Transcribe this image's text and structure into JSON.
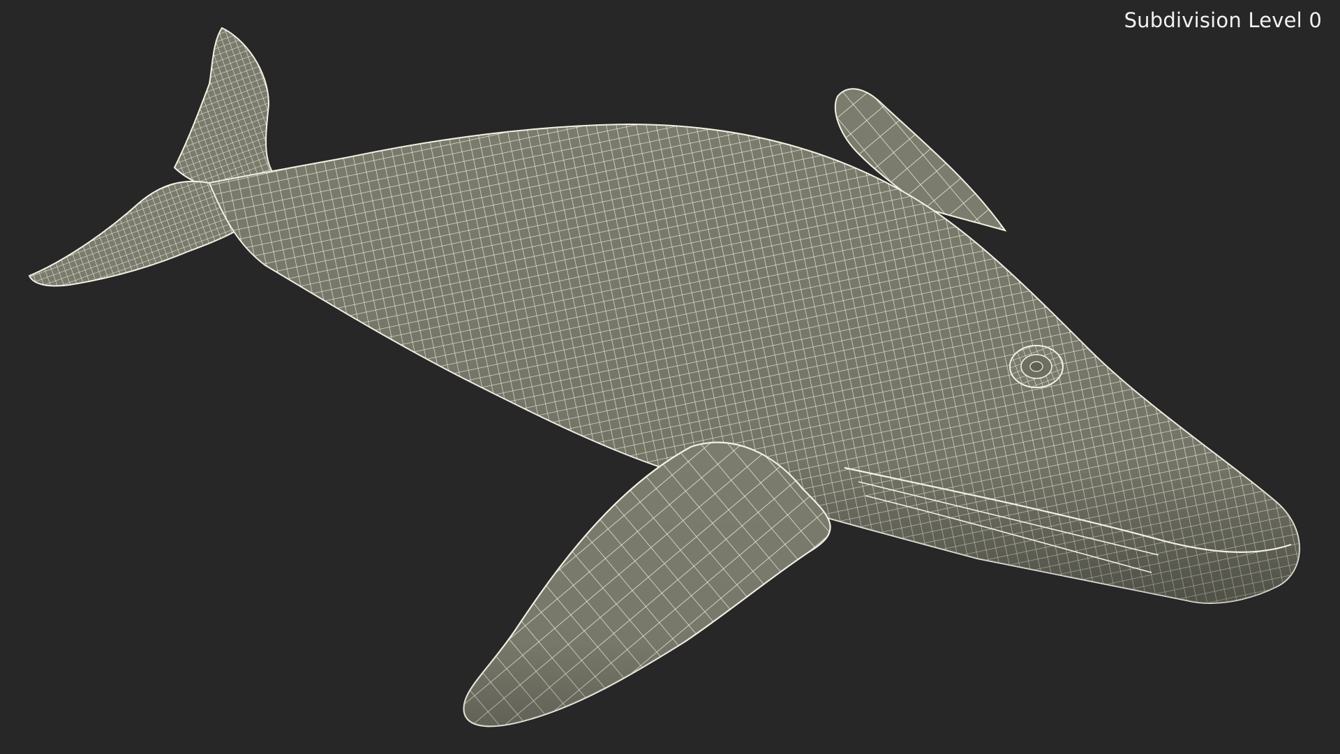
{
  "viewport": {
    "subdivision_label": "Subdivision Level 0",
    "background_color": "#272727",
    "mesh_fill_color": "#7a7b6c",
    "wire_color": "#f4f1e4"
  },
  "model": {
    "icon": "whale-wireframe-icon",
    "parts": [
      "body",
      "tail-fluke",
      "dorsal-fluke",
      "left-pectoral-fin",
      "right-pectoral-fin",
      "eye"
    ]
  }
}
